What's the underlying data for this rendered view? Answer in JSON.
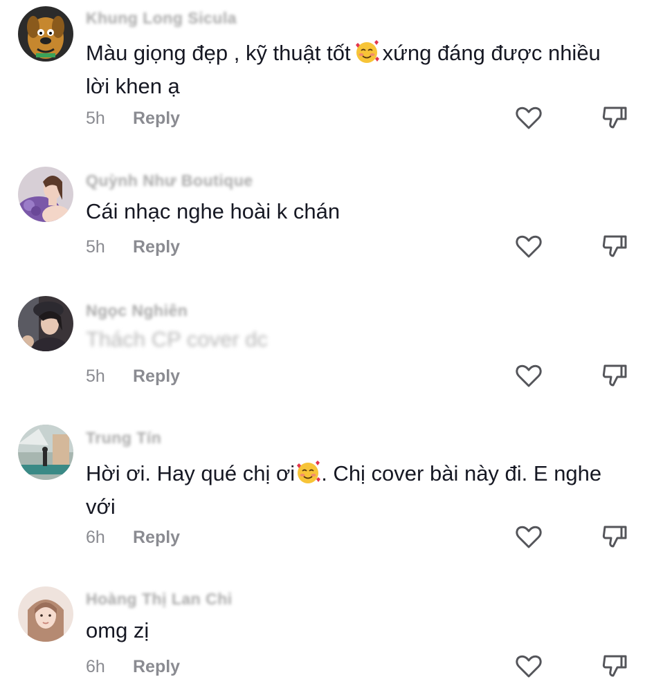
{
  "comments": [
    {
      "username": "Khung Long Sicula",
      "text_before_emoji": "Màu giọng đẹp , kỹ thuật tốt",
      "emoji": "smiling-face-with-hearts",
      "text_after_emoji": "xứng đáng được nhiều lời khen ạ",
      "time": "5h",
      "reply_label": "Reply"
    },
    {
      "username": "Quỳnh Như Boutique",
      "text": "Cái nhạc nghe hoài k chán",
      "time": "5h",
      "reply_label": "Reply"
    },
    {
      "username": "Ngọc Nghiên",
      "text": "Thách CP cover dc",
      "time": "5h",
      "reply_label": "Reply"
    },
    {
      "username": "Trung Tín",
      "text_before_emoji": "Hời ơi. Hay qué chị ơi",
      "emoji": "smiling-face-with-hearts",
      "text_after_emoji": ". Chị cover bài này đi. E nghe với",
      "time": "6h",
      "reply_label": "Reply"
    },
    {
      "username": "Hoàng Thị Lan Chi",
      "text": "omg zị",
      "time": "6h",
      "reply_label": "Reply"
    }
  ],
  "icons": {
    "like": "heart-outline-icon",
    "dislike": "thumbs-down-outline-icon"
  },
  "colors": {
    "text": "#161823",
    "meta": "#8a8b91",
    "icon": "#54555a"
  }
}
